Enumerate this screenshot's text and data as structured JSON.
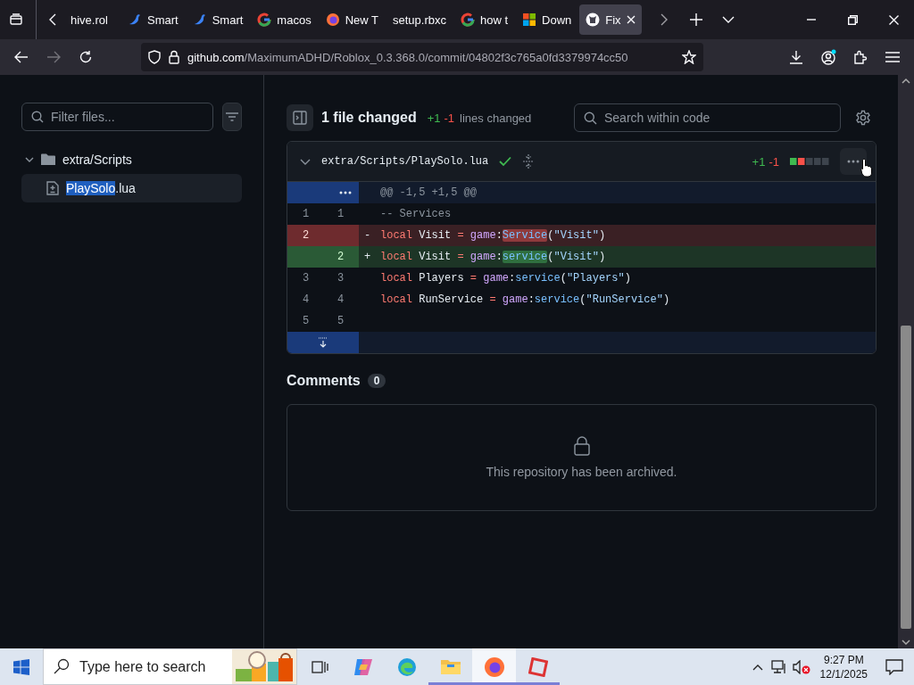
{
  "browser_tabs": [
    {
      "label": "hive.rol",
      "kind": "plain",
      "selected": false
    },
    {
      "label": "Smart",
      "kind": "bird",
      "selected": false
    },
    {
      "label": "Smart",
      "kind": "bird",
      "selected": false
    },
    {
      "label": "macos",
      "kind": "google",
      "selected": false
    },
    {
      "label": "New T",
      "kind": "firefox",
      "selected": false
    },
    {
      "label": "setup.rbxc",
      "kind": "plain",
      "selected": false
    },
    {
      "label": "how t",
      "kind": "google",
      "selected": false
    },
    {
      "label": "Down",
      "kind": "windows",
      "selected": false
    },
    {
      "label": "Fix",
      "kind": "github",
      "selected": true
    }
  ],
  "toolbar": {
    "forward_disabled": true,
    "url": {
      "host": "github.com",
      "path": "/MaximumADHD/Roblox_0.3.368.0/commit/04802f3c765a0fd3379974cc50"
    }
  },
  "sidebar": {
    "filter": {
      "placeholder": "Filter files..."
    },
    "tree": [
      {
        "kind": "folder",
        "name": "extra/Scripts",
        "expanded": true,
        "children": [
          {
            "kind": "file",
            "selected": true,
            "name_parts": [
              {
                "text": "PlaySolo",
                "highlighted": true
              },
              {
                "text": ".lua",
                "highlighted": false
              }
            ]
          }
        ]
      }
    ]
  },
  "summary": {
    "files_changed": "1 file changed",
    "additions": "+1",
    "deletions": "-1",
    "label": "lines changed"
  },
  "code_search": {
    "placeholder": "Search within code"
  },
  "file": {
    "path": "extra/Scripts/PlaySolo.lua",
    "expanded": true,
    "additions": "+1",
    "deletions": "-1",
    "hunk": "@@ -1,5 +1,5 @@",
    "lines": [
      {
        "kind": "context",
        "old": "1",
        "new": "1",
        "tokens": [
          {
            "text": "-- Services",
            "kind": "comment",
            "highlighted": false
          }
        ]
      },
      {
        "kind": "deletion",
        "old": "2",
        "sign": "-",
        "tokens": [
          {
            "text": "local",
            "kind": "keyword",
            "highlighted": false
          },
          {
            "text": " Visit ",
            "kind": "plain",
            "highlighted": false
          },
          {
            "text": "=",
            "kind": "operator",
            "highlighted": false
          },
          {
            "text": " game",
            "kind": "variable",
            "highlighted": false
          },
          {
            "text": ":",
            "kind": "plain",
            "highlighted": false
          },
          {
            "text": "Service",
            "kind": "method",
            "highlighted": true
          },
          {
            "text": "(",
            "kind": "plain",
            "highlighted": false
          },
          {
            "text": "\"Visit\"",
            "kind": "string",
            "highlighted": false
          },
          {
            "text": ")",
            "kind": "plain",
            "highlighted": false
          }
        ]
      },
      {
        "kind": "addition",
        "new": "2",
        "sign": "+",
        "tokens": [
          {
            "text": "local",
            "kind": "keyword",
            "highlighted": false
          },
          {
            "text": " Visit ",
            "kind": "plain",
            "highlighted": false
          },
          {
            "text": "=",
            "kind": "operator",
            "highlighted": false
          },
          {
            "text": " game",
            "kind": "variable",
            "highlighted": false
          },
          {
            "text": ":",
            "kind": "plain",
            "highlighted": false
          },
          {
            "text": "service",
            "kind": "method",
            "highlighted": true
          },
          {
            "text": "(",
            "kind": "plain",
            "highlighted": false
          },
          {
            "text": "\"Visit\"",
            "kind": "string",
            "highlighted": false
          },
          {
            "text": ")",
            "kind": "plain",
            "highlighted": false
          }
        ]
      },
      {
        "kind": "context",
        "old": "3",
        "new": "3",
        "tokens": [
          {
            "text": "local",
            "kind": "keyword",
            "highlighted": false
          },
          {
            "text": " Players ",
            "kind": "plain",
            "highlighted": false
          },
          {
            "text": "=",
            "kind": "operator",
            "highlighted": false
          },
          {
            "text": " game",
            "kind": "variable",
            "highlighted": false
          },
          {
            "text": ":",
            "kind": "plain",
            "highlighted": false
          },
          {
            "text": "service",
            "kind": "method",
            "highlighted": false
          },
          {
            "text": "(",
            "kind": "plain",
            "highlighted": false
          },
          {
            "text": "\"Players\"",
            "kind": "string",
            "highlighted": false
          },
          {
            "text": ")",
            "kind": "plain",
            "highlighted": false
          }
        ]
      },
      {
        "kind": "context",
        "old": "4",
        "new": "4",
        "tokens": [
          {
            "text": "local",
            "kind": "keyword",
            "highlighted": false
          },
          {
            "text": " RunService ",
            "kind": "plain",
            "highlighted": false
          },
          {
            "text": "=",
            "kind": "operator",
            "highlighted": false
          },
          {
            "text": " game",
            "kind": "variable",
            "highlighted": false
          },
          {
            "text": ":",
            "kind": "plain",
            "highlighted": false
          },
          {
            "text": "service",
            "kind": "method",
            "highlighted": false
          },
          {
            "text": "(",
            "kind": "plain",
            "highlighted": false
          },
          {
            "text": "\"RunService\"",
            "kind": "string",
            "highlighted": false
          },
          {
            "text": ")",
            "kind": "plain",
            "highlighted": false
          }
        ]
      },
      {
        "kind": "context",
        "old": "5",
        "new": "5"
      }
    ]
  },
  "comments": {
    "title": "Comments",
    "count": "0",
    "notice": "This repository has been archived."
  },
  "taskbar": {
    "search": {
      "placeholder": "Type here to search"
    },
    "apps": [
      {
        "kind": "task-view",
        "running": false,
        "active": false
      },
      {
        "kind": "copilot",
        "running": false,
        "active": false
      },
      {
        "kind": "edge",
        "running": false,
        "active": false
      },
      {
        "kind": "explorer",
        "running": true,
        "active": false
      },
      {
        "kind": "firefox",
        "running": true,
        "active": true
      },
      {
        "kind": "roblox",
        "running": true,
        "active": false
      }
    ],
    "time": "9:27 PM",
    "date": "12/1/2025"
  }
}
